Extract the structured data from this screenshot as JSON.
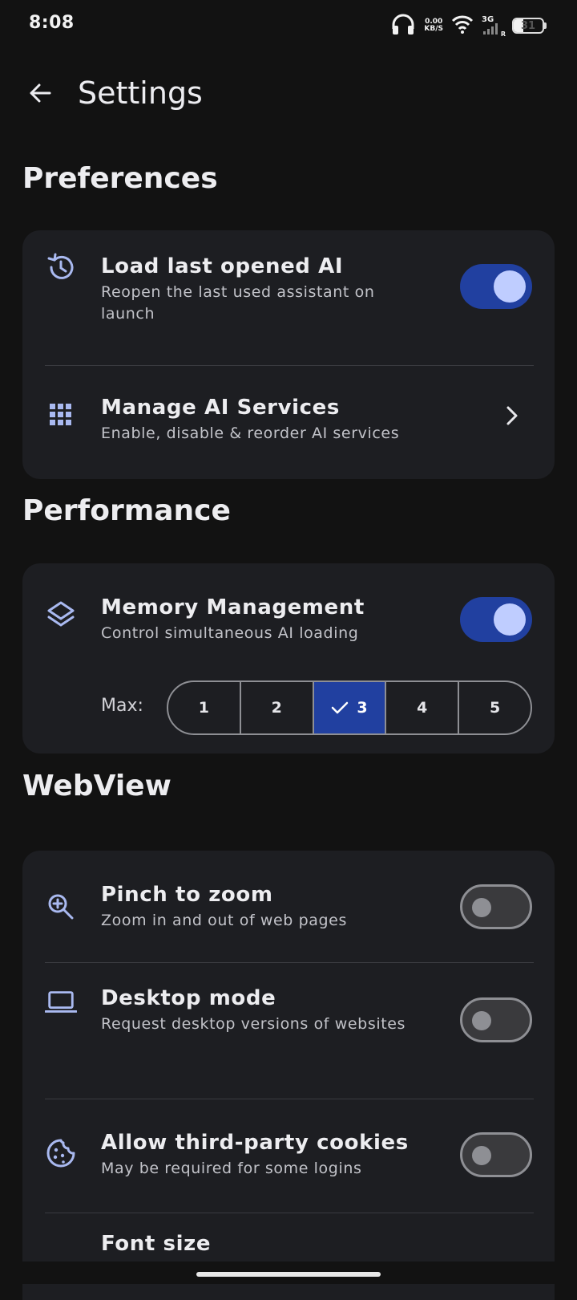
{
  "status_bar": {
    "time": "8:08",
    "net_speed_value": "0.00",
    "net_speed_unit": "KB/S",
    "network_type": "3G",
    "network_sub": "R",
    "battery": "31"
  },
  "app_bar": {
    "title": "Settings"
  },
  "sections": {
    "preferences": {
      "title": "Preferences",
      "load_last": {
        "title": "Load last opened AI",
        "subtitle": "Reopen the last used assistant on launch",
        "enabled": true
      },
      "manage_ai": {
        "title": "Manage AI Services",
        "subtitle": "Enable, disable & reorder AI services"
      }
    },
    "performance": {
      "title": "Performance",
      "memory": {
        "title": "Memory Management",
        "subtitle": "Control simultaneous AI loading",
        "enabled": true
      },
      "max_label": "Max:",
      "max_options": [
        "1",
        "2",
        "3",
        "4",
        "5"
      ],
      "max_selected": "3"
    },
    "webview": {
      "title": "WebView",
      "pinch": {
        "title": "Pinch to zoom",
        "subtitle": "Zoom in and out of web pages",
        "enabled": false
      },
      "desktop": {
        "title": "Desktop mode",
        "subtitle": "Request desktop versions of websites",
        "enabled": false
      },
      "cookies": {
        "title": "Allow third-party cookies",
        "subtitle": "May be required for some logins",
        "enabled": false
      },
      "font_size": {
        "title": "Font size"
      }
    }
  },
  "colors": {
    "background": "#121212",
    "card": "#1d1e22",
    "accent": "#2140a0",
    "accent_light": "#bfcdff",
    "icon": "#a9b9f0"
  },
  "icons": {
    "back": "arrow-left-icon",
    "history": "history-icon",
    "grid": "apps-grid-icon",
    "chevron": "chevron-right-icon",
    "layers": "layers-icon",
    "zoom": "zoom-in-icon",
    "laptop": "laptop-icon",
    "cookie": "cookie-icon",
    "check": "check-icon"
  }
}
